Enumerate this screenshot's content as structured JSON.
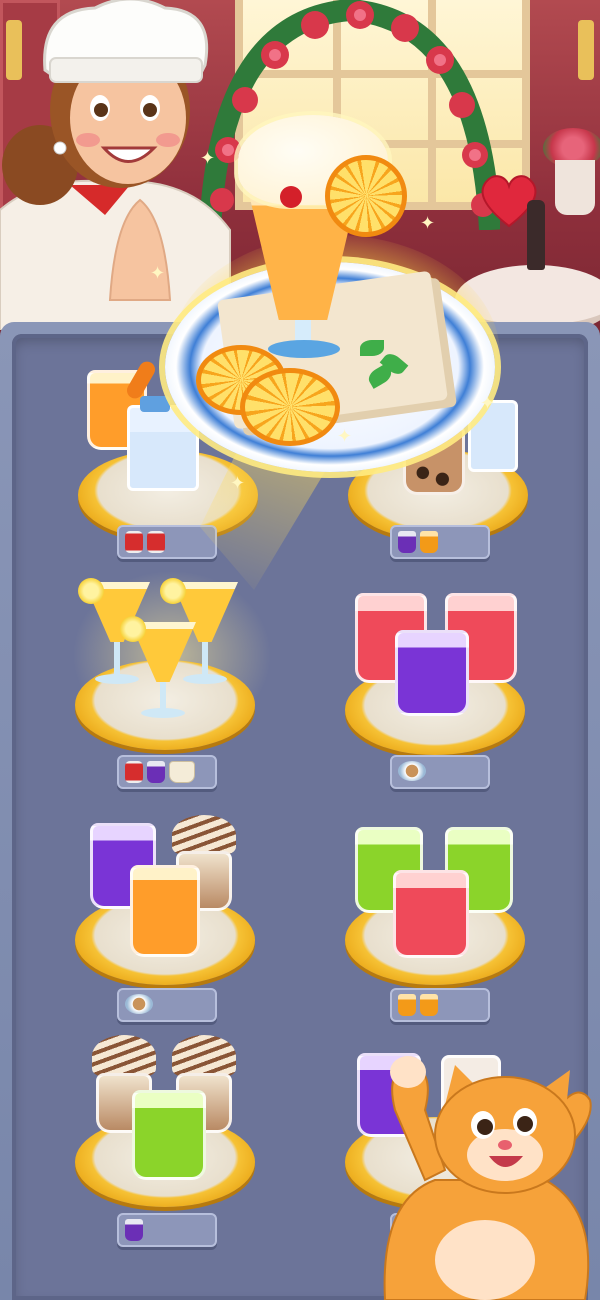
{
  "scene": {
    "colors": {
      "wall": "#9a3540",
      "board": "#7886aa",
      "board_inner": "#6c7499",
      "plate_rim": "#f6c235",
      "tray": "#8d96b9"
    }
  },
  "featured_order": {
    "item": "orange-cream-float-icon",
    "garnish": [
      "cherry-icon",
      "orange-slice-icon",
      "mint-icon"
    ]
  },
  "board": {
    "slots": [
      {
        "id": "slot-1",
        "contents": [
          "orange-juice-icon",
          "carrot-icon",
          "milk-carton-icon"
        ],
        "tray": [
          "cola-can-icon",
          "cola-can-icon"
        ]
      },
      {
        "id": "slot-2",
        "contents": [
          "bubble-tea-icon",
          "milk-carton-icon"
        ],
        "tray": [
          "grape-juice-icon",
          "orange-juice-icon"
        ]
      },
      {
        "id": "slot-3",
        "contents": [
          "lemon-cocktail-icon",
          "lemon-cocktail-icon",
          "lemon-cocktail-icon"
        ],
        "tray": [
          "cola-can-icon",
          "grape-juice-icon",
          "ice-cream-icon"
        ]
      },
      {
        "id": "slot-4",
        "contents": [
          "watermelon-juice-icon",
          "watermelon-juice-icon",
          "blueberry-juice-icon"
        ],
        "tray": [
          "coffee-cup-icon"
        ]
      },
      {
        "id": "slot-5",
        "contents": [
          "blueberry-juice-icon",
          "chocolate-sundae-icon",
          "carrot-juice-icon"
        ],
        "tray": [
          "coffee-cup-icon"
        ]
      },
      {
        "id": "slot-6",
        "contents": [
          "kiwi-juice-icon",
          "kiwi-juice-icon",
          "watermelon-juice-icon"
        ],
        "tray": [
          "orange-juice-icon",
          "orange-juice-icon"
        ]
      },
      {
        "id": "slot-7",
        "contents": [
          "chocolate-sundae-icon",
          "chocolate-sundae-icon",
          "kiwi-juice-icon"
        ],
        "tray": [
          "grape-juice-icon"
        ]
      },
      {
        "id": "slot-8",
        "contents": [
          "grape-juice-icon",
          "milkshake-icon"
        ],
        "tray": []
      }
    ]
  },
  "characters": [
    "chef-character",
    "cat-mascot"
  ]
}
